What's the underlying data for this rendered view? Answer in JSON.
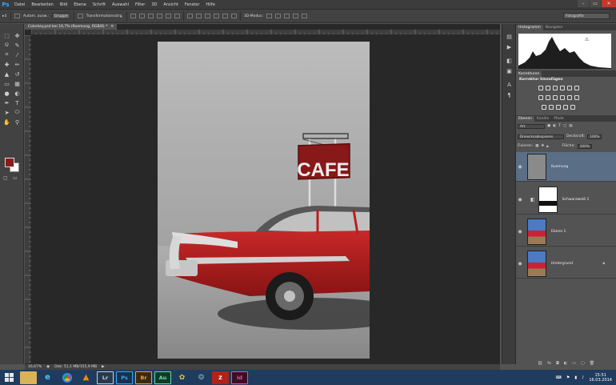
{
  "app": {
    "logo": "Ps",
    "accent": "#31a8ff"
  },
  "menubar": {
    "items": [
      "Datei",
      "Bearbeiten",
      "Bild",
      "Ebene",
      "Schrift",
      "Auswahl",
      "Filter",
      "3D",
      "Ansicht",
      "Fenster",
      "Hilfe"
    ],
    "window_controls": [
      "–",
      "▭",
      "✕"
    ]
  },
  "options": {
    "auto_select_label": "Autom. ausw.:",
    "auto_select_value": "Gruppe",
    "transform_label": "Transformationsstrg.",
    "mode_3d_label": "3D-Modus:",
    "workspace": "Fotografie"
  },
  "document": {
    "tab_title": "Colorkey.psd bei 16,7% (Kuemung, RGB/8) *",
    "zoom": "16,67%",
    "doc_info": "Dok: 51,1 MB/155,9 MB"
  },
  "canvas": {
    "sign_text": "CAFE"
  },
  "colors": {
    "foreground": "#8b1a1a",
    "background": "#ffffff",
    "selection": "#5a6e86",
    "car_red": "#b31e1e"
  },
  "panels": {
    "top_tabs": [
      "Histogramm",
      "Navigator"
    ],
    "adjustments_tabs": [
      "Korrekturen"
    ],
    "adjustments_title": "Korrektur hinzufügen",
    "layers_tabs": [
      "Ebenen",
      "Kanäle",
      "Pfade"
    ],
    "filter_kind": "Art",
    "blend_mode": "Dreiecksabkopieren",
    "opacity_label": "Deckkraft:",
    "opacity_value": "100%",
    "lock_label": "Fixieren:",
    "fill_label": "Fläche:",
    "fill_value": "100%",
    "layers": [
      {
        "name": "Kuemung",
        "selected": true,
        "italic": false
      },
      {
        "name": "Schwarzweiß 1",
        "selected": false,
        "italic": false
      },
      {
        "name": "Ebene 1",
        "selected": false,
        "italic": false
      },
      {
        "name": "Hintergrund",
        "selected": false,
        "italic": true
      }
    ]
  },
  "taskbar": {
    "apps": [
      {
        "label": "Lr",
        "bg": "#2a3a4a",
        "fg": "#b7d2f0"
      },
      {
        "label": "Ps",
        "bg": "#1d2f4a",
        "fg": "#31a8ff"
      },
      {
        "label": "Br",
        "bg": "#3a2a12",
        "fg": "#e5a33a"
      },
      {
        "label": "Au",
        "bg": "#123a2a",
        "fg": "#5fe0a8"
      },
      {
        "label": "Id",
        "bg": "#3a0f24",
        "fg": "#f24fa0"
      }
    ],
    "time": "15:51",
    "date": "16.03.2014"
  }
}
